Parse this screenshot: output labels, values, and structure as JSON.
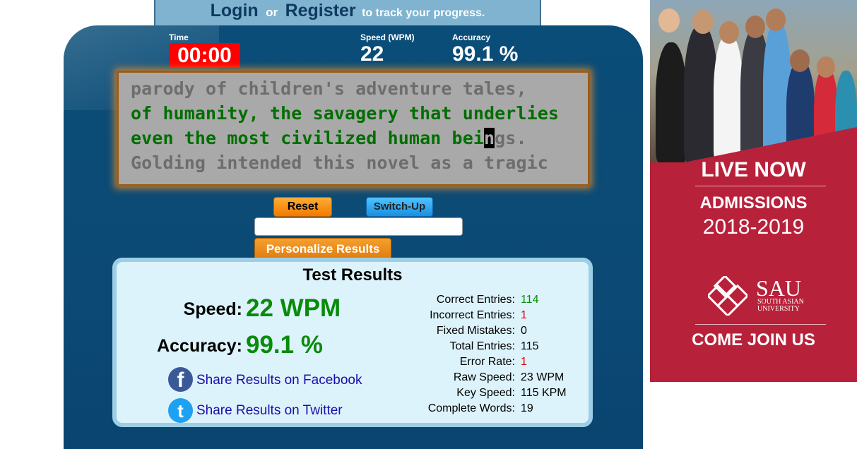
{
  "header": {
    "login_label": "Login",
    "or_label": "or",
    "register_label": "Register",
    "track_text": "to track your progress."
  },
  "stats": {
    "time_label": "Time",
    "time_value": "00:00",
    "speed_label": "Speed (WPM)",
    "speed_value": "22",
    "accuracy_label": "Accuracy",
    "accuracy_value": "99.1 %"
  },
  "typing_text": {
    "line1": "parody of children's adventure tales,",
    "line2": "of humanity, the savagery that underlies",
    "line3_typed": "even the most civilized human bei",
    "line3_cursor": "n",
    "line3_rest": "gs.",
    "line4": "Golding intended this novel as a tragic"
  },
  "controls": {
    "reset_label": "Reset",
    "switch_label": "Switch-Up",
    "input_value": "",
    "personalize_label": "Personalize Results"
  },
  "results": {
    "title": "Test Results",
    "speed_label": "Speed:",
    "speed_value": "22 WPM",
    "accuracy_label": "Accuracy:",
    "accuracy_value": "99.1 %",
    "share_facebook": "Share Results on Facebook",
    "share_twitter": "Share Results on Twitter",
    "details": [
      {
        "label": "Correct Entries:",
        "value": "114",
        "color": "#0a8a0a"
      },
      {
        "label": "Incorrect Entries:",
        "value": "1",
        "color": "#e00000"
      },
      {
        "label": "Fixed Mistakes:",
        "value": "0",
        "color": "#000000"
      },
      {
        "label": "Total Entries:",
        "value": "115",
        "color": "#000000"
      },
      {
        "label": "Error Rate:",
        "value": "1",
        "color": "#e00000"
      },
      {
        "label": "Raw Speed:",
        "value": "23 WPM",
        "color": "#000000"
      },
      {
        "label": "Key Speed:",
        "value": "115 KPM",
        "color": "#000000"
      },
      {
        "label": "Complete Words:",
        "value": "19",
        "color": "#000000"
      }
    ]
  },
  "ad": {
    "live_now": "LIVE NOW",
    "admissions": "ADMISSIONS",
    "years": "2018-2019",
    "sau": "SAU",
    "sau_sub1": "SOUTH ASIAN",
    "sau_sub2": "UNIVERSITY",
    "come_join": "COME JOIN US"
  },
  "colors": {
    "panel": "#0a4d78",
    "timer": "#ff0000",
    "typed_text": "#006e00",
    "pending_text": "#6d6d6d",
    "ad_background": "#b8213a"
  }
}
